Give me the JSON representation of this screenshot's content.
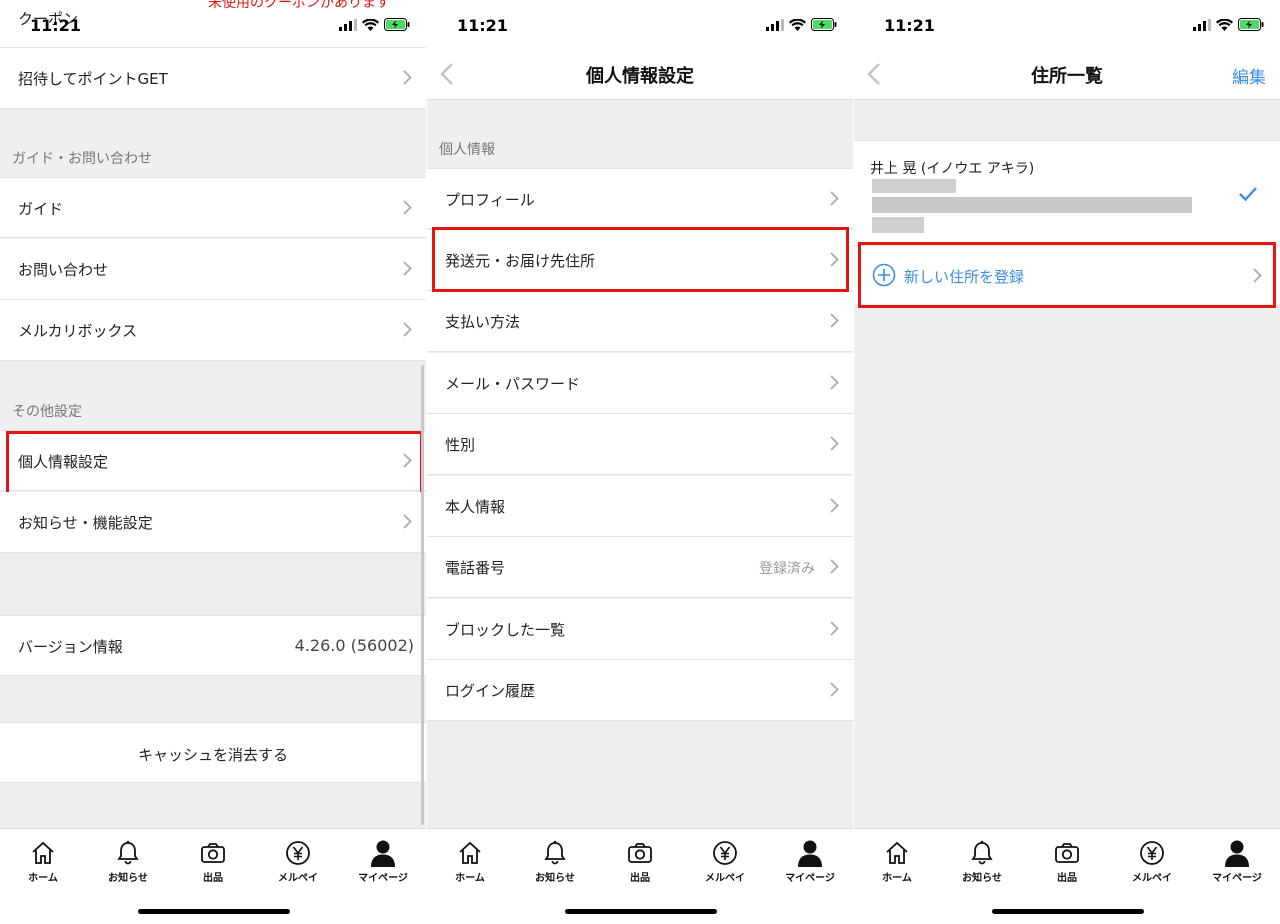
{
  "status_bar": {
    "time": "11:21"
  },
  "screen1": {
    "coupon_label": "クーポン",
    "coupon_note": "未使用のクーポンがあります",
    "invite_label": "招待してポイントGET",
    "section_guide": "ガイド・お問い合わせ",
    "guide_label": "ガイド",
    "contact_label": "お問い合わせ",
    "box_label": "メルカリボックス",
    "section_other": "その他設定",
    "personal_label": "個人情報設定",
    "notice_label": "お知らせ・機能設定",
    "version_label": "バージョン情報",
    "version_value": "4.26.0 (56002)",
    "cache_label": "キャッシュを消去する"
  },
  "screen2": {
    "title": "個人情報設定",
    "section": "個人情報",
    "items": [
      {
        "label": "プロフィール"
      },
      {
        "label": "発送元・お届け先住所"
      },
      {
        "label": "支払い方法"
      },
      {
        "label": "メール・パスワード"
      },
      {
        "label": "性別"
      },
      {
        "label": "本人情報"
      },
      {
        "label": "電話番号",
        "value": "登録済み"
      },
      {
        "label": "ブロックした一覧"
      },
      {
        "label": "ログイン履歴"
      }
    ]
  },
  "screen3": {
    "title": "住所一覧",
    "edit": "編集",
    "address_name": "井上 晃 (イノウエ アキラ)",
    "add_new": "新しい住所を登録"
  },
  "tabs": [
    {
      "label": "ホーム",
      "icon": "home-icon"
    },
    {
      "label": "お知らせ",
      "icon": "bell-icon"
    },
    {
      "label": "出品",
      "icon": "camera-icon"
    },
    {
      "label": "メルペイ",
      "icon": "yen-icon"
    },
    {
      "label": "マイページ",
      "icon": "person-icon"
    }
  ],
  "colors": {
    "highlight": "#e4140f",
    "accent": "#3a8ee6",
    "battery": "#4cd964"
  }
}
